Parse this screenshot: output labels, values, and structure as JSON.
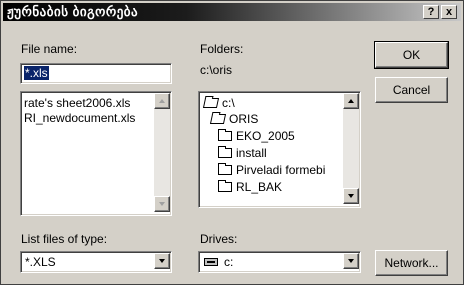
{
  "window": {
    "title": "ჟურნაბის ბიგორება",
    "help_glyph": "?",
    "close_glyph": "x"
  },
  "file_name": {
    "label": "File name:",
    "value": "*.xls",
    "files": [
      "rate's sheet2006.xls",
      "RI_newdocument.xls"
    ]
  },
  "folders": {
    "label": "Folders:",
    "current_path": "c:\\oris",
    "tree": [
      {
        "label": "c:\\",
        "icon": "open-folder-icon"
      },
      {
        "label": "ORIS",
        "icon": "open-folder-icon"
      },
      {
        "label": "EKO_2005",
        "icon": "folder-icon"
      },
      {
        "label": "install",
        "icon": "folder-icon"
      },
      {
        "label": "Pirveladi formebi",
        "icon": "folder-icon"
      },
      {
        "label": "RL_BAK",
        "icon": "folder-icon"
      }
    ]
  },
  "buttons": {
    "ok": "OK",
    "cancel": "Cancel",
    "network": "Network..."
  },
  "file_type": {
    "label": "List files of type:",
    "selected": "*.XLS"
  },
  "drives": {
    "label": "Drives:",
    "selected": "c:",
    "icon": "drive-icon"
  }
}
